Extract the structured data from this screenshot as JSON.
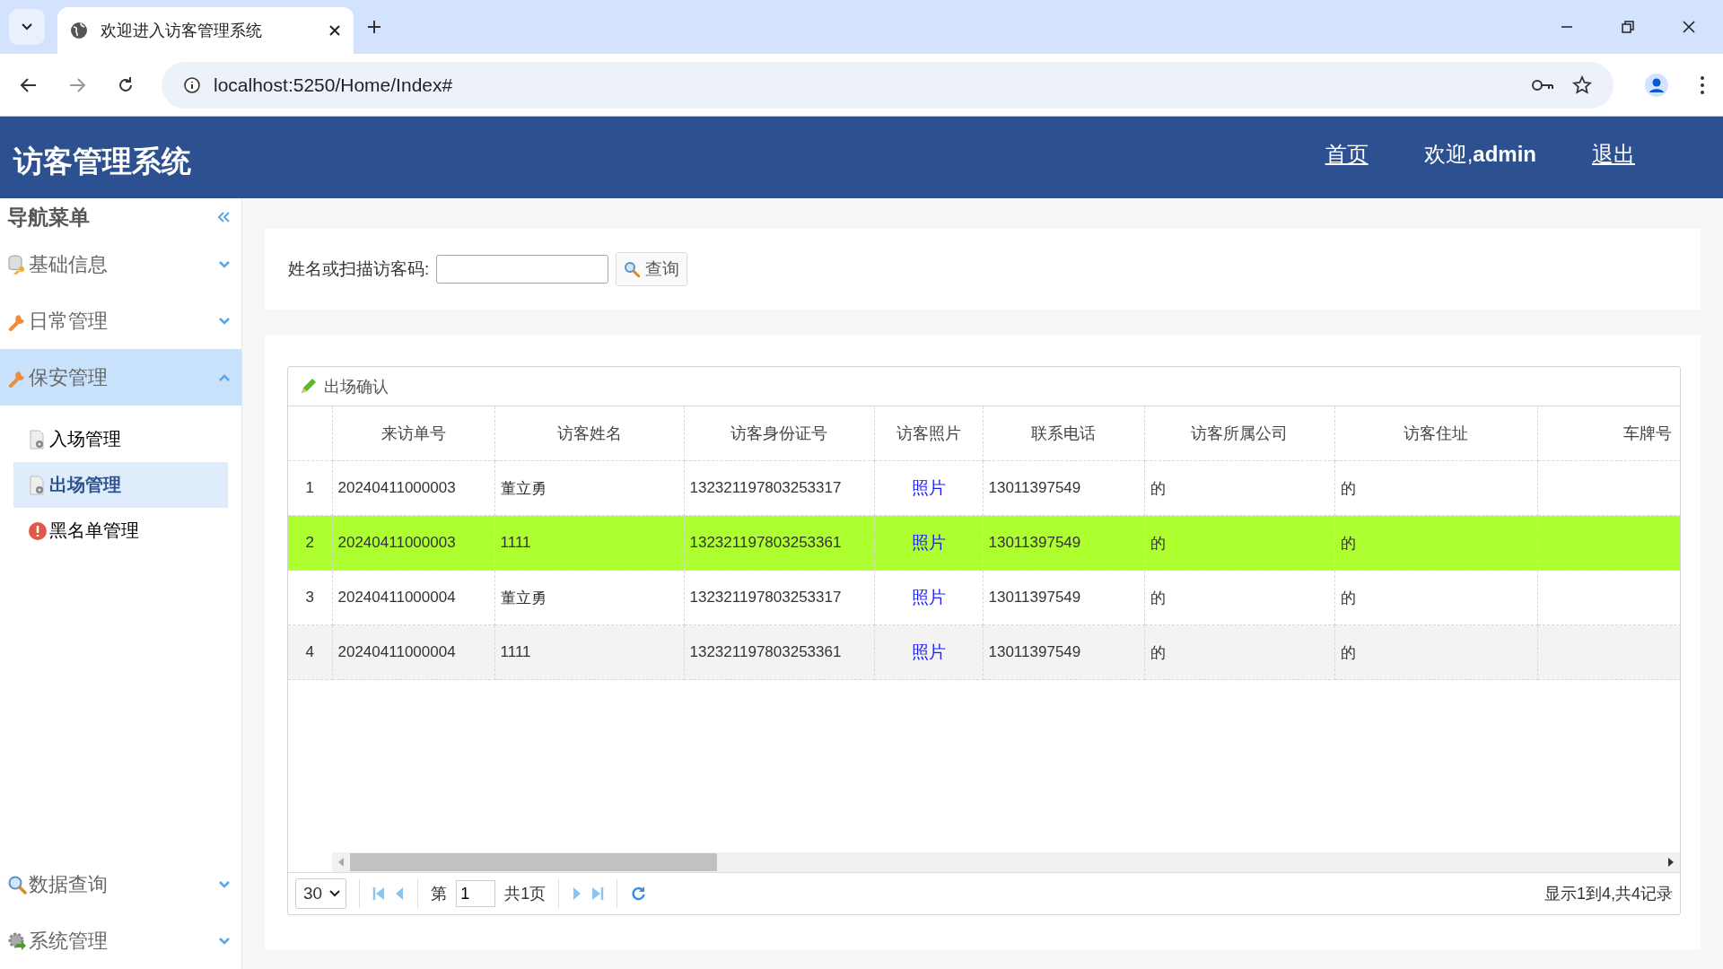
{
  "browser": {
    "tab_title": "欢迎进入访客管理系统",
    "url": "localhost:5250/Home/Index#"
  },
  "header": {
    "title": "访客管理系统",
    "links": [
      {
        "kind": "link",
        "label": "首页"
      },
      {
        "kind": "text",
        "label": "欢迎,**admin**"
      },
      {
        "kind": "link",
        "label": "退出"
      }
    ]
  },
  "sidebar": {
    "title": "导航菜单",
    "groups": [
      {
        "label": "基础信息",
        "expanded": false
      },
      {
        "label": "日常管理",
        "expanded": false
      },
      {
        "label": "保安管理",
        "expanded": true,
        "children": [
          {
            "label": "入场管理",
            "selected": false
          },
          {
            "label": "出场管理",
            "selected": true
          },
          {
            "label": "黑名单管理",
            "selected": false
          }
        ]
      },
      {
        "label": "数据查询",
        "expanded": false
      },
      {
        "label": "系统管理",
        "expanded": false
      }
    ]
  },
  "search": {
    "label": "姓名或扫描访客码:",
    "button": "查询"
  },
  "grid": {
    "title": "出场确认",
    "columns": [
      "来访单号",
      "访客姓名",
      "访客身份证号",
      "访客照片",
      "联系电话",
      "访客所属公司",
      "访客住址",
      "车牌号"
    ],
    "rows": [
      {
        "num": "1",
        "selected": false,
        "cells": [
          "20240411000003",
          "董立勇",
          "132321197803253317",
          "照片",
          "13011397549",
          "的",
          "的",
          ""
        ]
      },
      {
        "num": "2",
        "selected": true,
        "cells": [
          "20240411000003",
          "1111",
          "132321197803253361",
          "照片",
          "13011397549",
          "的",
          "的",
          ""
        ]
      },
      {
        "num": "3",
        "selected": false,
        "cells": [
          "20240411000004",
          "董立勇",
          "132321197803253317",
          "照片",
          "13011397549",
          "的",
          "的",
          ""
        ]
      },
      {
        "num": "4",
        "selected": false,
        "cells": [
          "20240411000004",
          "1111",
          "132321197803253361",
          "照片",
          "13011397549",
          "的",
          "的",
          ""
        ]
      }
    ]
  },
  "pager": {
    "page_size": "30",
    "before": "第",
    "page": "1",
    "after": "共1页",
    "summary": "显示1到4,共4记录"
  }
}
